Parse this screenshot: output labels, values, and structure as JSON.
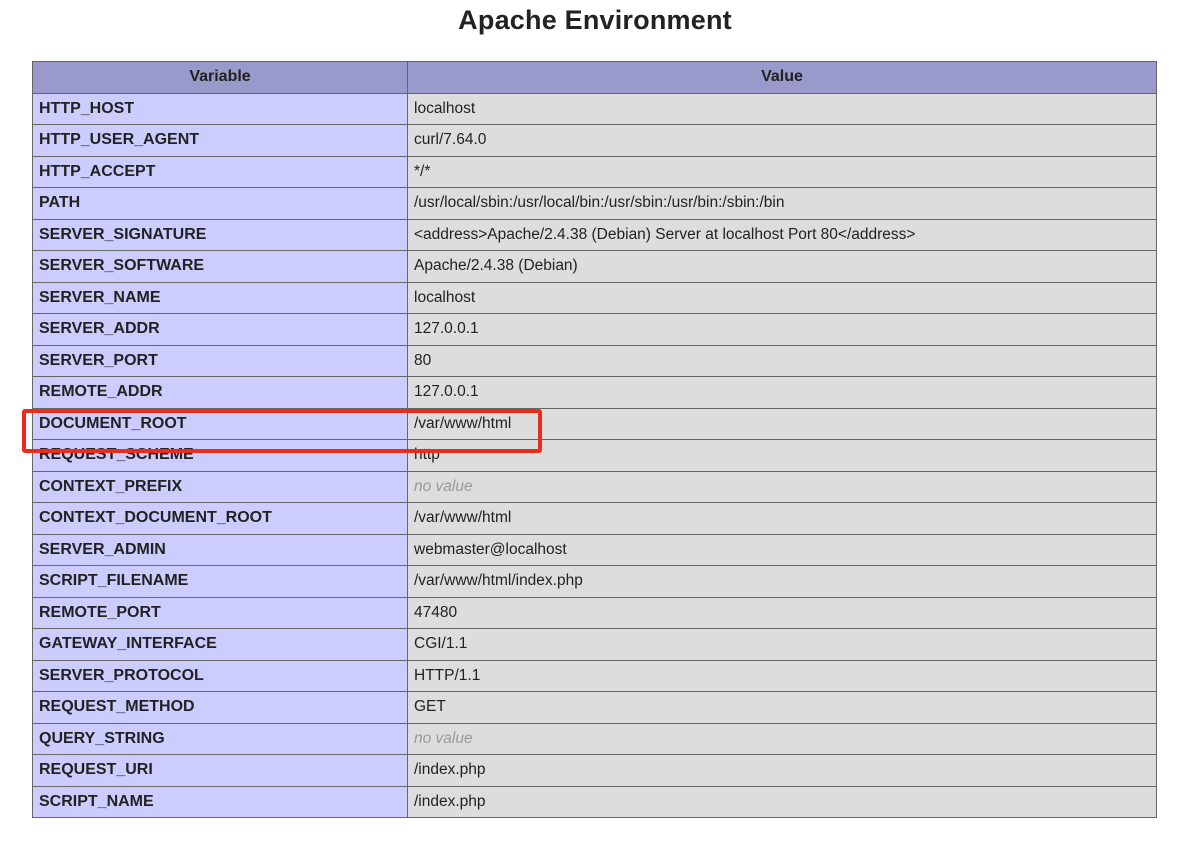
{
  "page": {
    "title": "Apache Environment"
  },
  "table": {
    "headers": {
      "variable": "Variable",
      "value": "Value"
    },
    "rows": [
      {
        "variable": "HTTP_HOST",
        "value": "localhost",
        "no_value": false
      },
      {
        "variable": "HTTP_USER_AGENT",
        "value": "curl/7.64.0",
        "no_value": false
      },
      {
        "variable": "HTTP_ACCEPT",
        "value": "*/*",
        "no_value": false
      },
      {
        "variable": "PATH",
        "value": "/usr/local/sbin:/usr/local/bin:/usr/sbin:/usr/bin:/sbin:/bin",
        "no_value": false
      },
      {
        "variable": "SERVER_SIGNATURE",
        "value": "<address>Apache/2.4.38 (Debian) Server at localhost Port 80</address>",
        "no_value": false
      },
      {
        "variable": "SERVER_SOFTWARE",
        "value": "Apache/2.4.38 (Debian)",
        "no_value": false
      },
      {
        "variable": "SERVER_NAME",
        "value": "localhost",
        "no_value": false
      },
      {
        "variable": "SERVER_ADDR",
        "value": "127.0.0.1",
        "no_value": false
      },
      {
        "variable": "SERVER_PORT",
        "value": "80",
        "no_value": false
      },
      {
        "variable": "REMOTE_ADDR",
        "value": "127.0.0.1",
        "no_value": false
      },
      {
        "variable": "DOCUMENT_ROOT",
        "value": "/var/www/html",
        "no_value": false,
        "highlighted": true
      },
      {
        "variable": "REQUEST_SCHEME",
        "value": "http",
        "no_value": false
      },
      {
        "variable": "CONTEXT_PREFIX",
        "value": "no value",
        "no_value": true
      },
      {
        "variable": "CONTEXT_DOCUMENT_ROOT",
        "value": "/var/www/html",
        "no_value": false
      },
      {
        "variable": "SERVER_ADMIN",
        "value": "webmaster@localhost",
        "no_value": false
      },
      {
        "variable": "SCRIPT_FILENAME",
        "value": "/var/www/html/index.php",
        "no_value": false
      },
      {
        "variable": "REMOTE_PORT",
        "value": "47480",
        "no_value": false
      },
      {
        "variable": "GATEWAY_INTERFACE",
        "value": "CGI/1.1",
        "no_value": false
      },
      {
        "variable": "SERVER_PROTOCOL",
        "value": "HTTP/1.1",
        "no_value": false
      },
      {
        "variable": "REQUEST_METHOD",
        "value": "GET",
        "no_value": false
      },
      {
        "variable": "QUERY_STRING",
        "value": "no value",
        "no_value": true
      },
      {
        "variable": "REQUEST_URI",
        "value": "/index.php",
        "no_value": false
      },
      {
        "variable": "SCRIPT_NAME",
        "value": "/index.php",
        "no_value": false
      }
    ]
  },
  "colors": {
    "header_bg": "#9999cc",
    "variable_bg": "#ccccff",
    "value_bg": "#dddddd",
    "no_value_text": "#999999",
    "highlight_border": "#ee2a1a"
  }
}
